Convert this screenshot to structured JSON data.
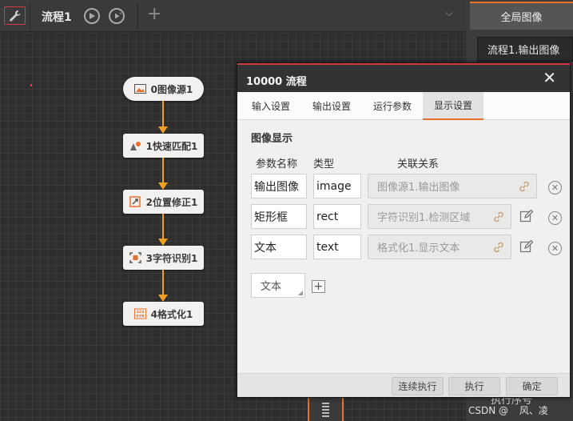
{
  "toolbar": {
    "flow_title": "流程1",
    "settings_icon": "wrench-icon",
    "run_once_icon": "play-circle-icon",
    "run_loop_icon": "loop-play-icon",
    "add_tab_icon": "plus-icon",
    "tabs_menu_icon": "chevron-down-icon"
  },
  "right_panel": {
    "global_tab": "全局图像",
    "output_tab": "流程1.输出图像",
    "exec_order": "执行序号",
    "watermark": "CSDN @",
    "watermark_name": "风、凌"
  },
  "flow_nodes": [
    {
      "label": "0图像源1",
      "icon": "image-icon"
    },
    {
      "label": "1快速匹配1",
      "icon": "match-icon"
    },
    {
      "label": "2位置修正1",
      "icon": "position-correct-icon"
    },
    {
      "label": "3字符识别1",
      "icon": "ocr-icon"
    },
    {
      "label": "4格式化1",
      "icon": "format-str-icon",
      "icon_text": "STR"
    }
  ],
  "dialog": {
    "title": "10000 流程",
    "tabs": [
      {
        "label": "输入设置",
        "active": false
      },
      {
        "label": "输出设置",
        "active": false
      },
      {
        "label": "运行参数",
        "active": false
      },
      {
        "label": "显示设置",
        "active": true
      }
    ],
    "section_title": "图像显示",
    "columns": {
      "name": "参数名称",
      "type": "类型",
      "link": "关联关系"
    },
    "rows": [
      {
        "name": "输出图像",
        "type": "image",
        "link": "图像源1.输出图像",
        "editable": false
      },
      {
        "name": "矩形框",
        "type": "rect",
        "link": "字符识别1.检测区域",
        "editable": true
      },
      {
        "name": "文本",
        "type": "text",
        "link": "格式化1.显示文本",
        "editable": true
      }
    ],
    "add_type_value": "文本",
    "footer": {
      "continuous_run": "连续执行",
      "run": "执行",
      "ok": "确定"
    }
  },
  "colors": {
    "accent": "#e8702a",
    "connector": "#f0a020",
    "alert_red": "#d23b3b"
  }
}
